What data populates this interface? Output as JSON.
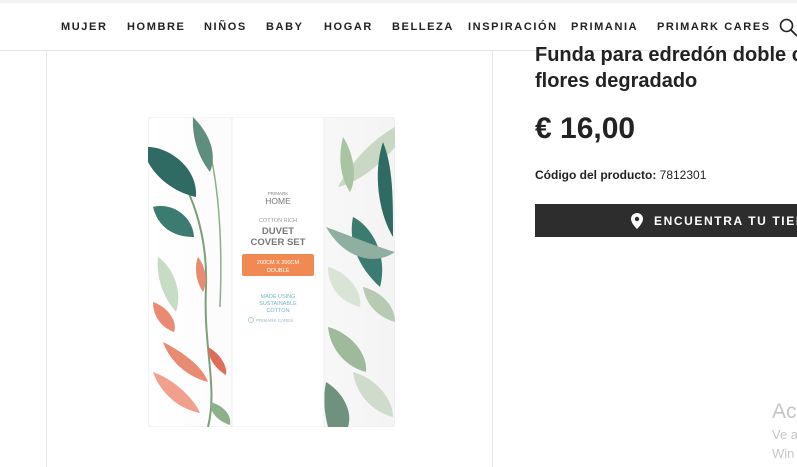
{
  "nav": {
    "items": [
      "MUJER",
      "HOMBRE",
      "NIÑOS",
      "BABY",
      "HOGAR",
      "BELLEZA",
      "INSPIRACIÓN",
      "PRIMANIA",
      "PRIMARK CARES"
    ]
  },
  "product": {
    "title_line1": "Funda para edredón doble co",
    "title_line2": "flores degradado",
    "price": "€ 16,00",
    "code_label": "Código del producto:",
    "code_value": "7812301",
    "store_button": "ENCUENTRA TU TIENDA"
  },
  "packaging": {
    "brand_small": "PRIMARK",
    "brand_home": "HOME",
    "line1": "COTTON RICH",
    "line2": "DUVET",
    "line3": "COVER SET",
    "size_line1": "200CM X 200CM",
    "size_line2": "DOUBLE",
    "made_line1": "MADE USING",
    "made_line2": "SUSTAINABLE",
    "made_line3": "COTTON",
    "cares": "PRIMARK CARES",
    "orange": "#f08a52",
    "teal": "#2f6b63"
  },
  "watermark": {
    "line1": "Act",
    "line2": "Ve a",
    "line3": "Win"
  }
}
